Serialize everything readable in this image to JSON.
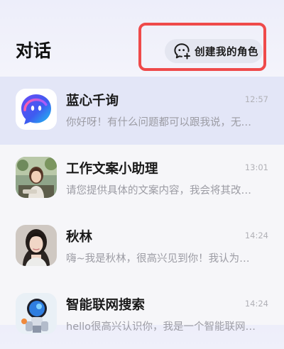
{
  "header": {
    "title": "对话",
    "create_button": {
      "label": "创建我的角色",
      "icon": "chat-bubble-plus-icon"
    },
    "highlight_color": "#ef4a4a"
  },
  "conversations": [
    {
      "title": "蓝心千询",
      "time": "12:57",
      "preview": "你好呀！有什么问题都可以跟我说，无…",
      "avatar": "bluecore-logo",
      "active": true
    },
    {
      "title": "工作文案小助理",
      "time": "13:01",
      "preview": "请您提供具体的文案内容，我会将其改…",
      "avatar": "assistant-portrait"
    },
    {
      "title": "秋林",
      "time": "14:24",
      "preview": "嗨~我是秋林，很高兴见到你！我认为…",
      "avatar": "qiulin-portrait"
    },
    {
      "title": "智能联网搜索",
      "time": "14:24",
      "preview": "hello很高兴认识你，我是一个智能联网…",
      "avatar": "robot-avatar"
    }
  ],
  "colors": {
    "accent": "#4a56e8",
    "active_row": "#e3e6f7"
  }
}
